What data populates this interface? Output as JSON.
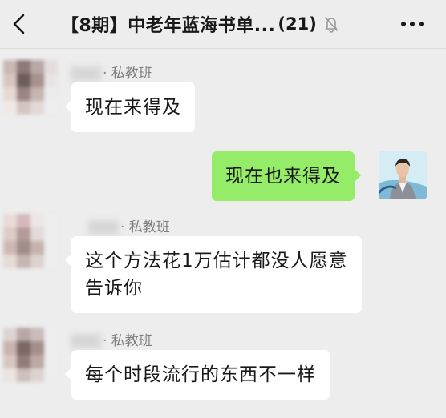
{
  "header": {
    "back_icon": "chevron-left-icon",
    "title": "【8期】中老年蓝海书单...",
    "member_count": "(21)",
    "mute_icon": "bell-off-icon",
    "more_icon": "more-dots-icon"
  },
  "colors": {
    "background": "#ededed",
    "bubble_incoming": "#ffffff",
    "bubble_outgoing": "#95ec69",
    "sender_name": "#7f7f7f"
  },
  "messages": [
    {
      "direction": "in",
      "sender": "· 私教班",
      "text": "现在来得及"
    },
    {
      "direction": "out",
      "text": "现在也来得及"
    },
    {
      "direction": "in",
      "sender": "· 私教班",
      "text_line1": "这个方法花1万估计都没人愿意",
      "text_line2": "告诉你"
    },
    {
      "direction": "in",
      "sender": "· 私教班",
      "text": "每个时段流行的东西不一样"
    }
  ]
}
